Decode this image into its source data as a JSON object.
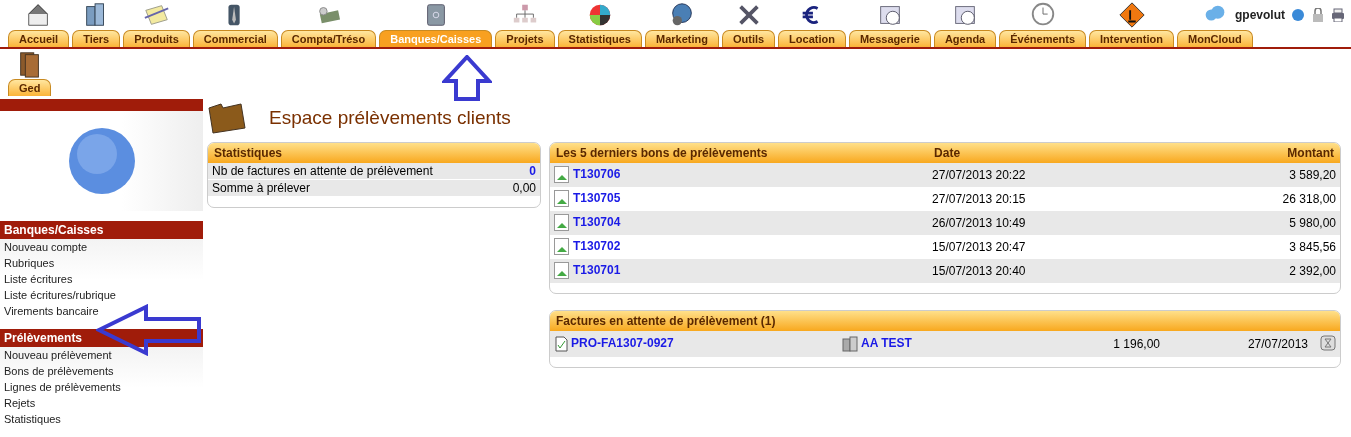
{
  "top_menu": [
    {
      "label": "Accueil",
      "selected": false
    },
    {
      "label": "Tiers",
      "selected": false
    },
    {
      "label": "Produits",
      "selected": false
    },
    {
      "label": "Commercial",
      "selected": false
    },
    {
      "label": "Compta/Tréso",
      "selected": false
    },
    {
      "label": "Banques/Caisses",
      "selected": true
    },
    {
      "label": "Projets",
      "selected": false
    },
    {
      "label": "Statistiques",
      "selected": false
    },
    {
      "label": "Marketing",
      "selected": false
    },
    {
      "label": "Outils",
      "selected": false
    },
    {
      "label": "Location",
      "selected": false
    },
    {
      "label": "Messagerie",
      "selected": false
    },
    {
      "label": "Agenda",
      "selected": false
    },
    {
      "label": "Événements",
      "selected": false
    },
    {
      "label": "Intervention",
      "selected": false
    },
    {
      "label": "MonCloud",
      "selected": false
    }
  ],
  "second_menu": [
    {
      "label": "Ged",
      "selected": false
    }
  ],
  "user": {
    "login": "gpevolut"
  },
  "sidebar": [
    {
      "title": "Banques/Caisses",
      "items": [
        "Nouveau compte",
        "Rubriques",
        "Liste écritures",
        "Liste écritures/rubrique",
        "Virements bancaire"
      ]
    },
    {
      "title": "Prélèvements",
      "items": [
        "Nouveau prélèvement",
        "Bons de prélèvements",
        "Lignes de prélèvements",
        "Rejets",
        "Statistiques"
      ]
    }
  ],
  "page_title": "Espace prélèvements clients",
  "stats": {
    "title": "Statistiques",
    "rows": [
      {
        "label": "Nb de factures en attente de prélèvement",
        "value": "0",
        "link": true
      },
      {
        "label": "Somme à prélever",
        "value": "0,00",
        "link": false
      }
    ]
  },
  "last_orders": {
    "columns": [
      "Les 5 derniers bons de prélèvements",
      "Date",
      "Montant"
    ],
    "rows": [
      {
        "ref": "T130706",
        "date": "27/07/2013 20:22",
        "amount": "3 589,20"
      },
      {
        "ref": "T130705",
        "date": "27/07/2013 20:15",
        "amount": "26 318,00"
      },
      {
        "ref": "T130704",
        "date": "26/07/2013 10:49",
        "amount": "5 980,00"
      },
      {
        "ref": "T130702",
        "date": "15/07/2013 20:47",
        "amount": "3 845,56"
      },
      {
        "ref": "T130701",
        "date": "15/07/2013 20:40",
        "amount": "2 392,00"
      }
    ]
  },
  "pending": {
    "title": "Factures en attente de prélèvement (1)",
    "rows": [
      {
        "ref": "PRO-FA1307-0927",
        "company": "AA TEST",
        "amount": "1 196,00",
        "date": "27/07/2013"
      }
    ]
  }
}
